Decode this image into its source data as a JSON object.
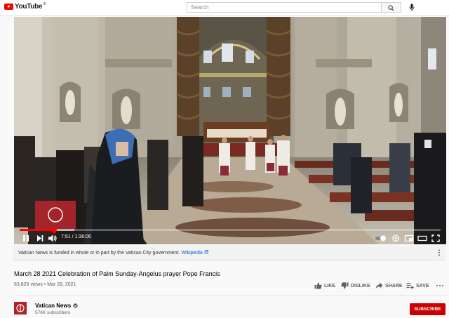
{
  "app": {
    "logo_text": "YouTube",
    "logo_country": "IE"
  },
  "search": {
    "placeholder": "Search"
  },
  "player": {
    "current_time": "7:51",
    "duration": "1:36:06",
    "played_fraction": 0.082,
    "loaded_fraction": 0.13,
    "icons": [
      "pause-icon",
      "next-icon",
      "volume-icon",
      "autoplay-toggle",
      "settings-icon",
      "miniplayer-icon",
      "theater-icon",
      "fullscreen-icon"
    ]
  },
  "info_panel": {
    "text": "Vatican News is funded in whole or in part by the Vatican City government.",
    "link": "Wikipedia"
  },
  "video": {
    "title": "March 28 2021 Celebration of Palm Sunday-Angelus prayer Pope Francis",
    "views": "63,826 views",
    "separator": "•",
    "date": "Mar 28, 2021"
  },
  "actions": {
    "like": "LIKE",
    "dislike": "DISLIKE",
    "share": "SHARE",
    "save": "SAVE"
  },
  "channel": {
    "name": "Vatican News",
    "subscribers": "576K subscribers",
    "subscribe_label": "SUBSCRIBE"
  },
  "colors": {
    "brand_red": "#ff0000",
    "subscribe_red": "#cc0000",
    "link_blue": "#065fd4"
  }
}
